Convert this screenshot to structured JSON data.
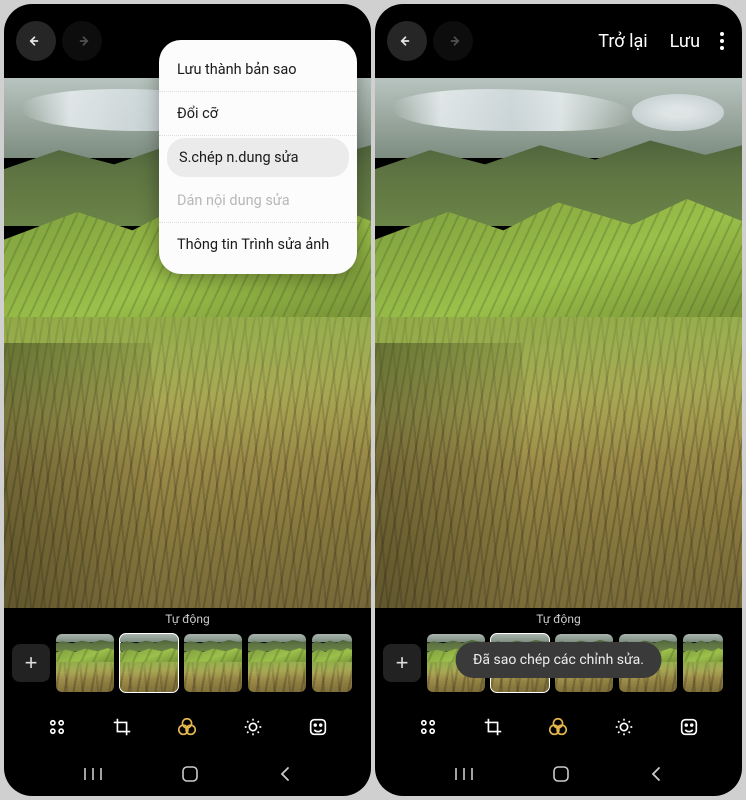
{
  "left": {
    "menu": {
      "items": [
        {
          "label": "Lưu thành bản sao",
          "state": "normal"
        },
        {
          "label": "Đổi cỡ",
          "state": "normal"
        },
        {
          "label": "S.chép n.dung sửa",
          "state": "highlight"
        },
        {
          "label": "Dán nội dung sửa",
          "state": "disabled"
        },
        {
          "label": "Thông tin Trình sửa ảnh",
          "state": "normal"
        }
      ]
    }
  },
  "right": {
    "header": {
      "back_label": "Trở lại",
      "save_label": "Lưu"
    },
    "toast": "Đã sao chép các chỉnh sửa."
  },
  "thumb_label": "Tự động",
  "add_label": "+",
  "colors": {
    "accent": "#e6b84e"
  }
}
